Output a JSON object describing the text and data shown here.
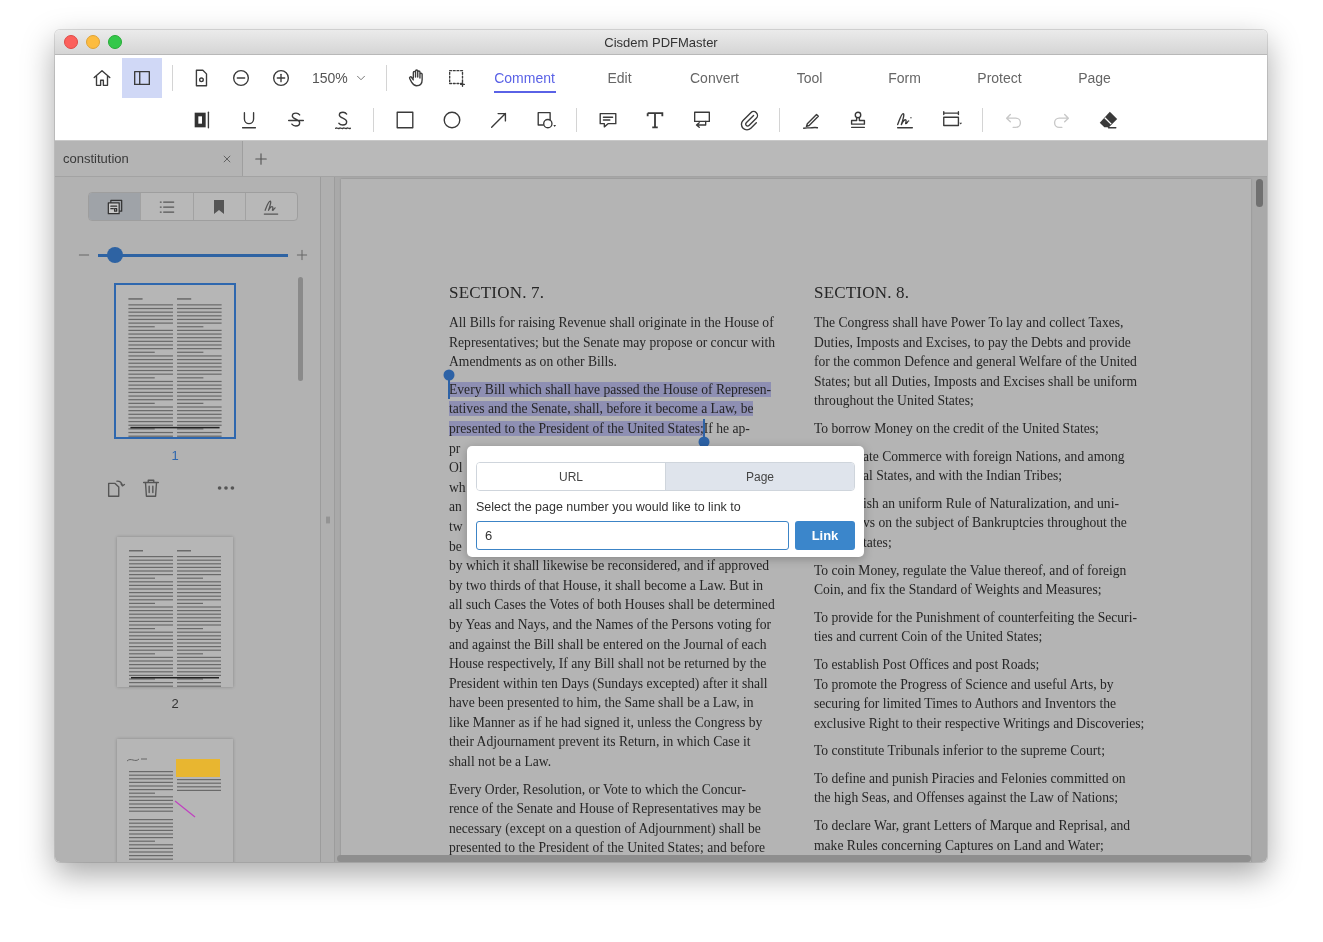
{
  "window": {
    "title": "Cisdem PDFMaster"
  },
  "toolbar": {
    "view_buttons": [
      {
        "kind": "home",
        "selected": false
      },
      {
        "kind": "sidebar_toggle",
        "selected": true
      }
    ],
    "page_tools": [
      {
        "kind": "page_settings"
      },
      {
        "kind": "zoom_out"
      },
      {
        "kind": "zoom_in"
      }
    ],
    "zoom": {
      "value": "150%"
    },
    "mode_tools": [
      {
        "kind": "pan"
      },
      {
        "kind": "marquee"
      }
    ],
    "tabs": [
      {
        "label": "Comment",
        "selected": true
      },
      {
        "label": "Edit",
        "selected": false
      },
      {
        "label": "Convert",
        "selected": false
      },
      {
        "label": "Tool",
        "selected": false
      },
      {
        "label": "Form",
        "selected": false
      },
      {
        "label": "Protect",
        "selected": false
      },
      {
        "label": "Page",
        "selected": false
      }
    ]
  },
  "annotation_tool_groups": [
    {
      "tools": [
        {
          "kind": "highlight",
          "disabled": false
        },
        {
          "kind": "underline",
          "disabled": false
        },
        {
          "kind": "strikethrough",
          "disabled": false
        },
        {
          "kind": "squiggly",
          "disabled": false
        }
      ]
    },
    {
      "tools": [
        {
          "kind": "rectangle",
          "disabled": false
        },
        {
          "kind": "ellipse",
          "disabled": false
        },
        {
          "kind": "arrow",
          "disabled": false
        },
        {
          "kind": "shapes",
          "disabled": false
        }
      ]
    },
    {
      "tools": [
        {
          "kind": "note",
          "disabled": false
        },
        {
          "kind": "text",
          "disabled": false
        },
        {
          "kind": "textbox",
          "disabled": false
        },
        {
          "kind": "attachment",
          "disabled": false
        }
      ]
    },
    {
      "tools": [
        {
          "kind": "pencil",
          "disabled": false
        },
        {
          "kind": "stamp",
          "disabled": false
        },
        {
          "kind": "signature",
          "disabled": false
        },
        {
          "kind": "form_field",
          "disabled": false
        }
      ]
    },
    {
      "tools": [
        {
          "kind": "undo",
          "disabled": true
        },
        {
          "kind": "redo",
          "disabled": true
        },
        {
          "kind": "eraser",
          "disabled": false
        }
      ]
    }
  ],
  "document_tabs": [
    {
      "label": "constitution"
    }
  ],
  "sidebar": {
    "view_tabs": [
      {
        "kind": "thumbnails",
        "selected": true
      },
      {
        "kind": "outline",
        "selected": false
      },
      {
        "kind": "bookmarks",
        "selected": false
      },
      {
        "kind": "signatures",
        "selected": false
      }
    ],
    "thumbnail_size": {
      "level": 0.09
    },
    "thumbnails": [
      {
        "label": "1",
        "selected": true,
        "kind": "plain"
      },
      {
        "label": "2",
        "selected": false,
        "kind": "plain"
      },
      {
        "selected": false,
        "kind": "annotated"
      }
    ]
  },
  "document": {
    "columns": [
      {
        "heading": "SECTION. 7.",
        "paragraphs": [
          {
            "kind": "text",
            "lines": [
              "All Bills for raising Revenue shall originate in the House of",
              "Representatives; but the Senate may propose or concur with",
              "Amendments as on other Bills."
            ]
          },
          {
            "kind": "selection",
            "lines": [
              {
                "segments": [
                  {
                    "text": "Every Bill which shall have passed the House of Represen-",
                    "selected": true
                  }
                ]
              },
              {
                "segments": [
                  {
                    "text": "tatives and the Senate, shall, before it become a Law, be",
                    "selected": true
                  }
                ]
              },
              {
                "segments": [
                  {
                    "text": "presented to the President of the United States;",
                    "selected": true
                  },
                  {
                    "text": "If he ap-",
                    "selected": false
                  }
                ]
              },
              {
                "segments": [
                  {
                    "text": "pr",
                    "selected": false
                  }
                ]
              },
              {
                "segments": [
                  {
                    "text": "Ol",
                    "selected": false
                  }
                ]
              },
              {
                "segments": [
                  {
                    "text": "wh",
                    "selected": false
                  }
                ]
              },
              {
                "segments": [
                  {
                    "text": "an",
                    "selected": false
                  }
                ]
              },
              {
                "segments": [
                  {
                    "text": "tw",
                    "selected": false
                  }
                ]
              },
              {
                "segments": [
                  {
                    "text": "be",
                    "selected": false
                  }
                ]
              },
              {
                "segments": [
                  {
                    "text": "by which it shall likewise be reconsidered, and if approved",
                    "selected": false
                  }
                ]
              },
              {
                "segments": [
                  {
                    "text": "by two thirds of that House, it shall become a Law. But in",
                    "selected": false
                  }
                ]
              },
              {
                "segments": [
                  {
                    "text": "all such Cases the Votes of both Houses shall be determined",
                    "selected": false
                  }
                ]
              },
              {
                "segments": [
                  {
                    "text": "by Yeas and Nays, and the Names of the Persons voting for",
                    "selected": false
                  }
                ]
              },
              {
                "segments": [
                  {
                    "text": "and against the Bill shall be entered on the Journal of each",
                    "selected": false
                  }
                ]
              },
              {
                "segments": [
                  {
                    "text": "House respectively, If any Bill shall not be returned by the",
                    "selected": false
                  }
                ]
              },
              {
                "segments": [
                  {
                    "text": "President within ten Days (Sundays excepted) after it shall",
                    "selected": false
                  }
                ]
              },
              {
                "segments": [
                  {
                    "text": "have been presented to him, the Same shall be a Law, in",
                    "selected": false
                  }
                ]
              },
              {
                "segments": [
                  {
                    "text": "like Manner as if he had signed it, unless the Congress by",
                    "selected": false
                  }
                ]
              },
              {
                "segments": [
                  {
                    "text": "their Adjournament prevent its Return, in which Case it",
                    "selected": false
                  }
                ]
              },
              {
                "segments": [
                  {
                    "text": "shall not be a Law.",
                    "selected": false
                  }
                ]
              }
            ]
          },
          {
            "kind": "text",
            "lines": [
              "Every Order, Resolution, or Vote to which the Concur-",
              "rence of the Senate and House of Representatives may be",
              "necessary (except on a question of Adjournment) shall be",
              "presented to the President of the United States; and before"
            ]
          }
        ]
      },
      {
        "heading": "SECTION. 8.",
        "paragraphs": [
          {
            "kind": "text",
            "lines": [
              "The Congress shall have Power To lay and collect Taxes,",
              "Duties, Imposts and Excises, to pay the Debts and provide",
              "for the common Defence and general Welfare of the United",
              "States; but all Duties, Imposts and Excises shall be uniform",
              "throughout the United States;"
            ]
          },
          {
            "kind": "text",
            "lines": [
              "To borrow Money on the credit of the United States;"
            ]
          },
          {
            "kind": "behind_popup",
            "lines": [
              "ate Commerce with foreign Nations, and among",
              "al States, and with the Indian Tribes;"
            ]
          },
          {
            "kind": "behind_popup",
            "lines": [
              "ish an uniform Rule of Naturalization, and uni-",
              "vs on the subject of Bankruptcies throughout the",
              "tates;"
            ]
          },
          {
            "kind": "text",
            "lines": [
              "To coin Money, regulate the Value thereof, and of foreign",
              "Coin, and fix the Standard of Weights and Measures;"
            ]
          },
          {
            "kind": "text",
            "lines": [
              "To provide for the Punishment of counterfeiting the Securi-",
              "ties and current Coin of the United States;"
            ]
          },
          {
            "kind": "text",
            "lines": [
              "To establish Post Offices and post Roads;",
              "To promote the Progress of Science and useful Arts, by",
              "securing for limited Times to Authors and Inventors the",
              "exclusive Right to their respective Writings and Discoveries;"
            ]
          },
          {
            "kind": "text",
            "lines": [
              "To constitute Tribunals inferior to the supreme Court;"
            ]
          },
          {
            "kind": "text",
            "lines": [
              "To define and punish Piracies and Felonies committed on",
              "the high Seas, and Offenses against the Law of Nations;"
            ]
          },
          {
            "kind": "text",
            "lines": [
              "To declare War, grant Letters of Marque and Reprisal, and",
              "make Rules concerning Captures on Land and Water;"
            ]
          }
        ]
      }
    ]
  },
  "link_popup": {
    "tabs": [
      {
        "label": "URL",
        "selected": false
      },
      {
        "label": "Page",
        "selected": true
      }
    ],
    "prompt": "Select the page number you would like to link to",
    "page_field": {
      "value": "6"
    },
    "button": "Link"
  }
}
